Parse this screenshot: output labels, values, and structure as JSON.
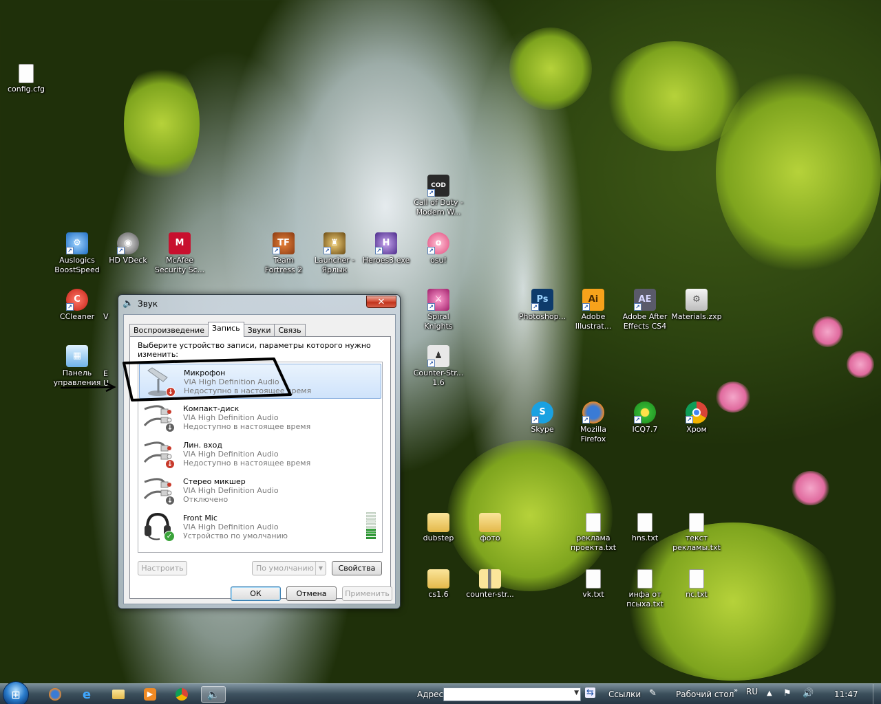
{
  "desktop": {
    "icons": [
      {
        "label": "config.cfg",
        "icon": "text-file-icon"
      },
      {
        "label": "Auslogics BoostSpeed",
        "icon": "auslogics-icon"
      },
      {
        "label": "HD VDeck",
        "icon": "hd-vdeck-icon"
      },
      {
        "label": "McAfee Security Sc...",
        "icon": "mcafee-icon"
      },
      {
        "label": "Team Fortress 2",
        "icon": "team-fortress-icon"
      },
      {
        "label": "Launcher - Ярлык",
        "icon": "launcher-icon"
      },
      {
        "label": "Heroes3.exe",
        "icon": "heroes3-icon"
      },
      {
        "label": "osu!",
        "icon": "osu-icon"
      },
      {
        "label": "Call of Duty - Modern W...",
        "icon": "call-of-duty-icon"
      },
      {
        "label": "CCleaner",
        "icon": "ccleaner-icon"
      },
      {
        "label": "Spiral Knights",
        "icon": "spiral-knights-icon"
      },
      {
        "label": "Photoshop...",
        "icon": "photoshop-icon"
      },
      {
        "label": "Adobe Illustrat...",
        "icon": "illustrator-icon"
      },
      {
        "label": "Adobe After Effects CS4",
        "icon": "after-effects-icon"
      },
      {
        "label": "Materials.zxp",
        "icon": "zxp-file-icon"
      },
      {
        "label": "Панель управления",
        "icon": "control-panel-icon"
      },
      {
        "label": "Counter-Str... 1.6",
        "icon": "counter-strike-icon"
      },
      {
        "label": "Skype",
        "icon": "skype-icon"
      },
      {
        "label": "Mozilla Firefox",
        "icon": "firefox-icon"
      },
      {
        "label": "ICQ7.7",
        "icon": "icq-icon"
      },
      {
        "label": "Хром",
        "icon": "chrome-icon"
      },
      {
        "label": "dubstep",
        "icon": "folder-icon"
      },
      {
        "label": "фото",
        "icon": "folder-icon"
      },
      {
        "label": "реклама проекта.txt",
        "icon": "text-file-icon"
      },
      {
        "label": "hns.txt",
        "icon": "text-file-icon"
      },
      {
        "label": "текст рекламы.txt",
        "icon": "text-file-icon"
      },
      {
        "label": "cs1.6",
        "icon": "folder-icon"
      },
      {
        "label": "counter-str...",
        "icon": "zip-folder-icon"
      },
      {
        "label": "vk.txt",
        "icon": "text-file-icon"
      },
      {
        "label": "инфа от псыха.txt",
        "icon": "text-file-icon"
      },
      {
        "label": "nc.txt",
        "icon": "text-file-icon"
      },
      {
        "label": "V",
        "icon": "partial-icon"
      },
      {
        "label": "E",
        "icon": "partial-icon"
      },
      {
        "label": "U",
        "icon": "partial-icon"
      }
    ]
  },
  "dialog": {
    "title": "Звук",
    "close_label": "✕",
    "tabs": [
      {
        "label": "Воспроизведение",
        "active": false
      },
      {
        "label": "Запись",
        "active": true
      },
      {
        "label": "Звуки",
        "active": false
      },
      {
        "label": "Связь",
        "active": false
      }
    ],
    "instruction": "Выберите устройство записи, параметры которого нужно изменить:",
    "devices": [
      {
        "name": "Микрофон",
        "driver": "VIA High Definition Audio",
        "status": "Недоступно в настоящее время",
        "icon": "microphone-icon",
        "badge": "down-arrow",
        "selected": true
      },
      {
        "name": "Компакт-диск",
        "driver": "VIA High Definition Audio",
        "status": "Недоступно в настоящее время",
        "icon": "rca-cable-icon",
        "badge": "down-arrow-gray",
        "selected": false
      },
      {
        "name": "Лин. вход",
        "driver": "VIA High Definition Audio",
        "status": "Недоступно в настоящее время",
        "icon": "rca-cable-icon",
        "badge": "down-arrow",
        "selected": false
      },
      {
        "name": "Стерео микшер",
        "driver": "VIA High Definition Audio",
        "status": "Отключено",
        "icon": "rca-cable-icon",
        "badge": "down-arrow-gray",
        "selected": false
      },
      {
        "name": "Front Mic",
        "driver": "VIA High Definition Audio",
        "status": "Устройство по умолчанию",
        "icon": "headset-icon",
        "badge": "checkmark",
        "selected": false,
        "level_segments_lit": 4,
        "level_segments_total": 10
      }
    ],
    "buttons": {
      "configure": "Настроить",
      "default": "По умолчанию",
      "properties": "Свойства",
      "ok": "ОК",
      "cancel": "Отмена",
      "apply": "Применить"
    }
  },
  "taskbar": {
    "address_label": "Адрес",
    "address_value": "",
    "links_label": "Ссылки",
    "desktop_label": "Рабочий стол",
    "language": "RU",
    "time": "11:47",
    "items": [
      {
        "icon": "firefox-icon"
      },
      {
        "icon": "internet-explorer-icon"
      },
      {
        "icon": "explorer-folder-icon"
      },
      {
        "icon": "media-player-icon"
      },
      {
        "icon": "chrome-icon"
      },
      {
        "icon": "sound-dialog-icon",
        "active": true
      }
    ]
  }
}
